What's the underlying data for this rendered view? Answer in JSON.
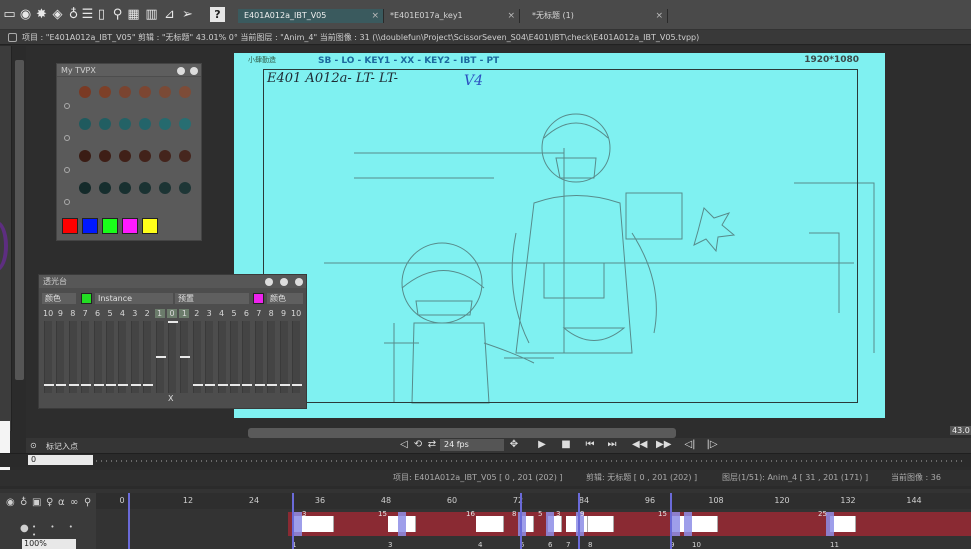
{
  "toolbar": {
    "tabs": [
      {
        "label": "E401A012a_IBT_V05",
        "active": true
      },
      {
        "label": "*E401E017a_key1",
        "active": false
      },
      {
        "label": "*无标题 (1)",
        "active": false
      }
    ],
    "close_glyph": "×"
  },
  "infobar": {
    "text": "项目 : \"E401A012a_IBT_V05\" 剪辑 : \"无标题\" 43.01% 0° 当前图层 : \"Anim_4\" 当前图像 : 31 (\\\\doublefun\\Project\\ScissorSeven_S04\\E401\\IBT\\check\\E401A012a_IBT_V05.tvpp)"
  },
  "canvas": {
    "logo": "小肆勤造",
    "header": "SB - LO - KEY1 - XX - KEY2 - IBT - PT",
    "resolution": "1920*1080",
    "scene_label": "E401 A012a- LT- LT-",
    "mark": "V4"
  },
  "tvpx": {
    "title": "My TVPX",
    "rows": [
      [
        "#7a3a24",
        "#7d4028",
        "#7a4430",
        "#7c4632",
        "#7a4a36",
        "#7d4c38"
      ],
      [
        "#1f5a5e",
        "#215e62",
        "#236266",
        "#23646a",
        "#256a6e",
        "#276e72"
      ],
      [
        "#3a1c14",
        "#3e1e16",
        "#402018",
        "#42221a",
        "#44241c",
        "#46261e"
      ],
      [
        "#142a2a",
        "#162e2e",
        "#183030",
        "#1a3232",
        "#1c3434",
        "#1e3636"
      ]
    ],
    "bright_colors": [
      "#ff0000",
      "#0018ff",
      "#19ff19",
      "#ff19ff",
      "#ffff19"
    ]
  },
  "lighttable": {
    "title": "透光台",
    "left_mode": "颜色",
    "instance_label": "Instance",
    "preset_label": "预置",
    "right_mode": "颜色",
    "left_chip_color": "#22dd22",
    "right_chip_color": "#ee22ee",
    "numbers": [
      "10",
      "9",
      "8",
      "7",
      "6",
      "5",
      "4",
      "3",
      "2",
      "1",
      "0",
      "1",
      "2",
      "3",
      "4",
      "5",
      "6",
      "7",
      "8",
      "9",
      "10"
    ],
    "center_mark": "X"
  },
  "viewer": {
    "fps": "24 fps",
    "zoom": "43.0",
    "marker_label": "标记入点",
    "scrub_value": "0"
  },
  "status": {
    "project": "项目: E401A012a_IBT_V05 [ 0 , 201 (202) ]",
    "clip": "剪辑: 无标题 [ 0 , 201 (202) ]",
    "layer": "图层(1/51): Anim_4 [ 31 , 201 (171) ]",
    "current": "当前图像 : 36"
  },
  "timeline": {
    "ruler": [
      "0",
      "12",
      "24",
      "36",
      "48",
      "60",
      "72",
      "84",
      "96",
      "108",
      "120",
      "132",
      "144"
    ],
    "frame_labels": [
      "1",
      "3",
      "4",
      "5",
      "6",
      "7",
      "8",
      "9",
      "10",
      "11"
    ],
    "key_labels": [
      "3",
      "15",
      "16",
      "8",
      "5",
      "3",
      "9",
      "15",
      "25"
    ],
    "zoom": "100%"
  }
}
